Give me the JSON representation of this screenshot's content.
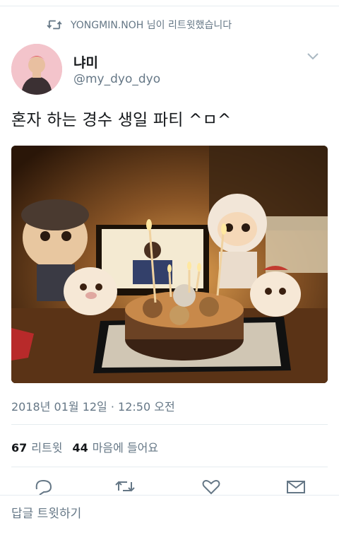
{
  "retweet_context": "YONGMIN.NOH 님이 리트윗했습니다",
  "author": {
    "name": "냐미",
    "handle": "@my_dyo_dyo"
  },
  "tweet": {
    "text": "혼자 하는 경수 생일 파티 ^ㅁ^"
  },
  "timestamp": "2018년 01월 12일 · 12:50 오전",
  "stats": {
    "retweets_count": "67",
    "retweets_label": "리트윗",
    "likes_count": "44",
    "likes_label": "마음에 들어요"
  },
  "actions": [
    "reply-icon",
    "retweet-icon",
    "like-icon",
    "message-icon"
  ],
  "reply_bar": {
    "placeholder": "답글 트윗하기"
  },
  "colors": {
    "secondary_text": "#657786",
    "divider": "#e6ecf0",
    "primary_text": "#14171a"
  }
}
